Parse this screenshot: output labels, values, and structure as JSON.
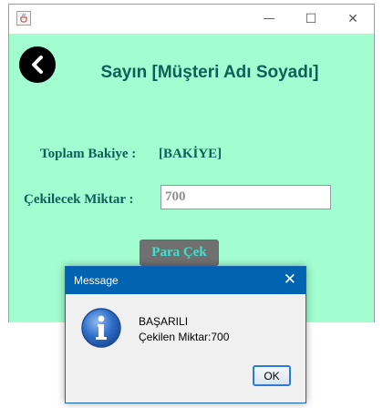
{
  "window": {
    "app_icon": "java-cup-icon",
    "controls": {
      "minimize_glyph": "—",
      "maximize_glyph": "☐",
      "close_glyph": "✕"
    }
  },
  "main": {
    "back_icon": "chevron-left-icon",
    "title": "Sayın [Müşteri Adı Soyadı]",
    "balance_label": "Toplam Bakiye :",
    "balance_value": "[BAKİYE]",
    "amount_label": "Çekilecek Miktar :",
    "amount_value": "700",
    "withdraw_button": "Para Çek",
    "colors": {
      "background": "#a2fdd0",
      "text": "#0e5f5a",
      "button_bg": "#707070",
      "button_text": "#3de3ce"
    }
  },
  "dialog": {
    "title": "Message",
    "close_glyph": "✕",
    "icon": "info-icon",
    "message_line1": "BAŞARILI",
    "message_line2": "Çekilen Miktar:700",
    "ok_label": "OK",
    "colors": {
      "titlebar": "#0063b1"
    }
  }
}
